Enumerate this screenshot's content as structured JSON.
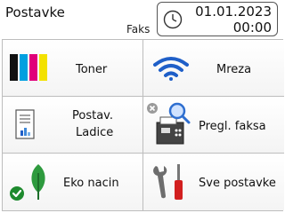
{
  "header": {
    "title": "Postavke",
    "mode_label": "Faks",
    "date": "01.01.2023",
    "time": "00:00"
  },
  "tiles": [
    {
      "id": "toner",
      "label": "Toner",
      "icon": "toner-cartridges-icon"
    },
    {
      "id": "network",
      "label": "Mreza",
      "icon": "wifi-icon"
    },
    {
      "id": "tray",
      "label_line1": "Postav.",
      "label_line2": "Ladice",
      "icon": "paper-tray-icon"
    },
    {
      "id": "fax_preview",
      "label": "Pregl. faksa",
      "icon": "fax-preview-icon"
    },
    {
      "id": "eco",
      "label": "Eko nacin",
      "icon": "eco-leaf-icon"
    },
    {
      "id": "all_settings",
      "label": "Sve postavke",
      "icon": "tools-icon"
    }
  ],
  "colors": {
    "toner_black": "#111111",
    "toner_cyan": "#00a0e0",
    "toner_magenta": "#e0007a",
    "toner_yellow": "#f3e100",
    "wifi_blue": "#1f5fc8",
    "leaf_green": "#2e9a3e",
    "check_green": "#1e8a2e",
    "screwdriver_red": "#d21f1f"
  }
}
